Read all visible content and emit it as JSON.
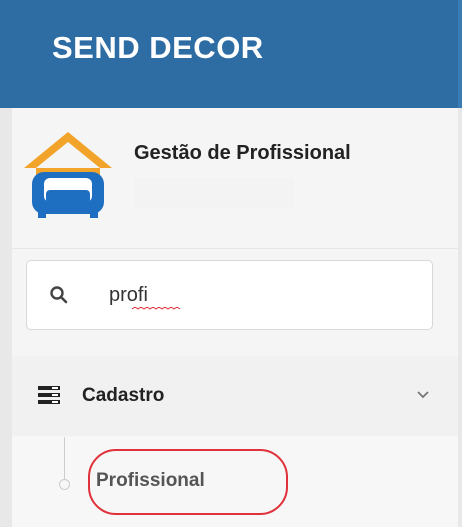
{
  "header": {
    "title": "SEND DECOR"
  },
  "profile": {
    "name": "Gestão de Profissional",
    "logo_icon": "sofa-house-icon"
  },
  "search": {
    "value": "profi",
    "icon": "search-icon"
  },
  "menu": {
    "items": [
      {
        "label": "Cadastro",
        "icon": "list-icon",
        "expanded": true,
        "children": [
          {
            "label": "Profissional",
            "highlighted": true
          }
        ]
      }
    ]
  },
  "colors": {
    "header_bg": "#2e6da4",
    "highlight": "#e0303a",
    "logo_blue": "#1e6fc1",
    "logo_orange": "#f2a42a"
  }
}
